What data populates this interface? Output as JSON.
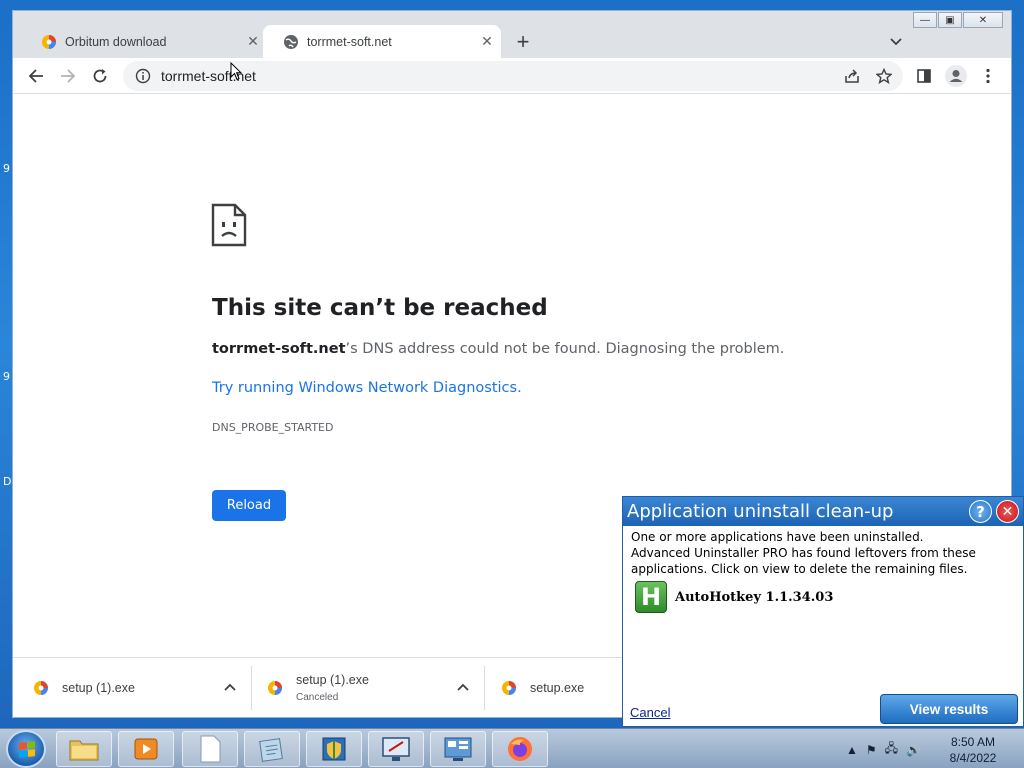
{
  "desktop": {
    "edge_glyphs": [
      "9",
      "9",
      "D"
    ]
  },
  "browser": {
    "tabs": [
      {
        "title": "Orbitum download",
        "icon": "orbitum-icon",
        "active": false
      },
      {
        "title": "torrmet-soft.net",
        "icon": "globe-icon",
        "active": true
      }
    ],
    "window_controls": {
      "minimize": "—",
      "maximize": "▣",
      "close": "✕"
    },
    "address_bar": {
      "url": "torrmet-soft.net"
    },
    "error_page": {
      "title": "This site can’t be reached",
      "domain": "torrmet-soft.net",
      "description_suffix": "’s DNS address could not be found. Diagnosing the problem.",
      "link": "Try running Windows Network Diagnostics.",
      "code": "DNS_PROBE_STARTED",
      "reload_label": "Reload"
    },
    "downloads": [
      {
        "filename": "setup (1).exe",
        "status": ""
      },
      {
        "filename": "setup (1).exe",
        "status": "Canceled"
      },
      {
        "filename": "setup.exe",
        "status": ""
      }
    ]
  },
  "popup": {
    "title": "Application uninstall clean-up",
    "message": "One or more applications have been uninstalled. Advanced Uninstaller PRO has found leftovers from these applications. Click on view to delete the remaining files.",
    "app_icon_letter": "H",
    "app_name": "AutoHotkey 1.1.34.03",
    "cancel_label": "Cancel",
    "view_label": "View results"
  },
  "taskbar": {
    "items": [
      "file-explorer",
      "media-player",
      "notepad",
      "editor",
      "security-center",
      "remote-desktop",
      "control-panel",
      "firefox"
    ],
    "time": "8:50 AM",
    "date": "8/4/2022"
  },
  "colors": {
    "link_blue": "#1a73e8",
    "popup_header": "#1e63b5"
  }
}
